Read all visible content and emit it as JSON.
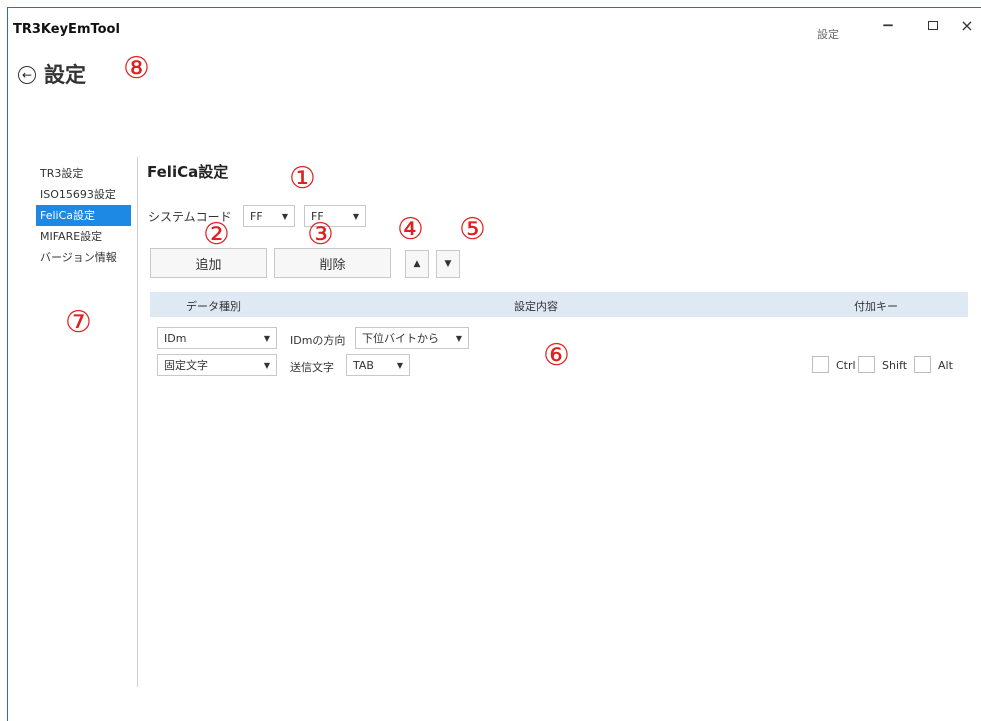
{
  "titlebar": {
    "app_title": "TR3KeyEmTool",
    "label": "設定",
    "minimize": "−",
    "close": "×"
  },
  "page": {
    "back": "←",
    "title": "設定"
  },
  "nav": {
    "items": [
      {
        "label": "TR3設定"
      },
      {
        "label": "ISO15693設定"
      },
      {
        "label": "FeliCa設定"
      },
      {
        "label": "MIFARE設定"
      },
      {
        "label": "バージョン情報"
      }
    ]
  },
  "felica": {
    "title": "FeliCa設定",
    "system_code_label": "システムコード",
    "system_code": [
      "FF",
      "FF"
    ],
    "add_label": "追加",
    "delete_label": "削除",
    "up_glyph": "▲",
    "down_glyph": "▼",
    "dropdown_glyph": "▼"
  },
  "grid": {
    "headers": {
      "data_type": "データ種別",
      "settings": "設定内容",
      "modifier_keys": "付加キー"
    },
    "rows": [
      {
        "type": "IDm",
        "setting_label": "IDmの方向",
        "setting_value": "下位バイトから"
      },
      {
        "type": "固定文字",
        "setting_label": "送信文字",
        "setting_value": "TAB",
        "keys": [
          "Ctrl",
          "Shift",
          "Alt"
        ]
      }
    ]
  },
  "annotations": [
    "①",
    "②",
    "③",
    "④",
    "⑤",
    "⑥",
    "⑦",
    "⑧"
  ],
  "colors": {
    "accent": "#1e88e5",
    "annotation": "#e02020",
    "grid_header": "#dfe9f3",
    "window_border": "#2b6fb6"
  }
}
